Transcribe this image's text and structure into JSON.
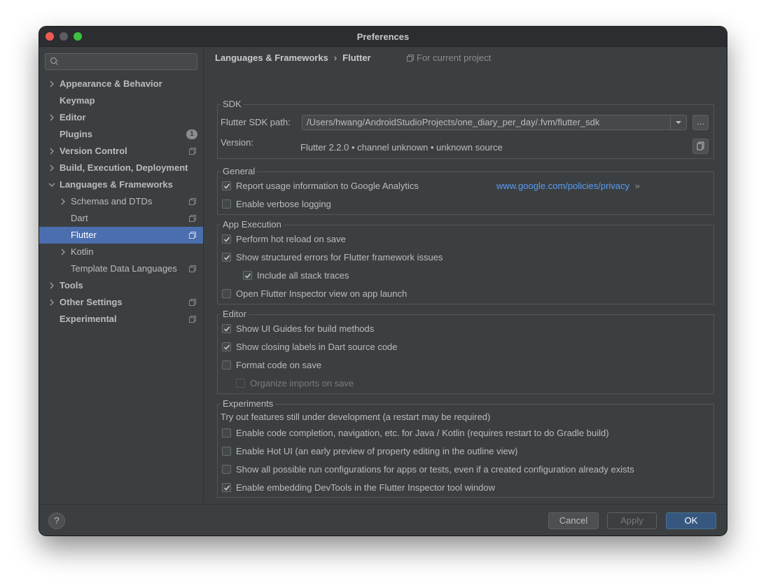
{
  "window": {
    "title": "Preferences"
  },
  "sidebar": {
    "search_placeholder": "",
    "badge_plugins": "1",
    "items": [
      {
        "label": "Appearance & Behavior"
      },
      {
        "label": "Keymap"
      },
      {
        "label": "Editor"
      },
      {
        "label": "Plugins"
      },
      {
        "label": "Version Control"
      },
      {
        "label": "Build, Execution, Deployment"
      },
      {
        "label": "Languages & Frameworks"
      },
      {
        "label": "Schemas and DTDs"
      },
      {
        "label": "Dart"
      },
      {
        "label": "Flutter"
      },
      {
        "label": "Kotlin"
      },
      {
        "label": "Template Data Languages"
      },
      {
        "label": "Tools"
      },
      {
        "label": "Other Settings"
      },
      {
        "label": "Experimental"
      }
    ]
  },
  "breadcrumb": {
    "parent": "Languages & Frameworks",
    "separator": "›",
    "current": "Flutter",
    "scope": "For current project"
  },
  "sdk": {
    "legend": "SDK",
    "path_label": "Flutter SDK path:",
    "path_value": "/Users/hwang/AndroidStudioProjects/one_diary_per_day/.fvm/flutter_sdk",
    "browse_label": "...",
    "version_label": "Version:",
    "version_value": "Flutter 2.2.0 • channel unknown • unknown source"
  },
  "general": {
    "legend": "General",
    "report_usage": "Report usage information to Google Analytics",
    "privacy_link": "www.google.com/policies/privacy",
    "privacy_arrow": "»",
    "verbose_logging": "Enable verbose logging"
  },
  "app_execution": {
    "legend": "App Execution",
    "hot_reload": "Perform hot reload on save",
    "structured_errors": "Show structured errors for Flutter framework issues",
    "stack_traces": "Include all stack traces",
    "open_inspector": "Open Flutter Inspector view on app launch"
  },
  "editor": {
    "legend": "Editor",
    "ui_guides": "Show UI Guides for build methods",
    "closing_labels": "Show closing labels in Dart source code",
    "format_on_save": "Format code on save",
    "organize_imports": "Organize imports on save"
  },
  "experiments": {
    "legend": "Experiments",
    "description": "Try out features still under development (a restart may be required)",
    "code_completion": "Enable code completion, navigation, etc. for Java / Kotlin (requires restart to do Gradle build)",
    "hot_ui": "Enable Hot UI (an early preview of property editing in the outline view)",
    "run_configs": "Show all possible run configurations for apps or tests, even if a created configuration already exists",
    "devtools": "Enable embedding DevTools in the Flutter Inspector tool window"
  },
  "footer": {
    "help": "?",
    "cancel": "Cancel",
    "apply": "Apply",
    "ok": "OK"
  },
  "colors": {
    "selection": "#4b6eaf",
    "link": "#589df6",
    "ok_button": "#365880"
  }
}
